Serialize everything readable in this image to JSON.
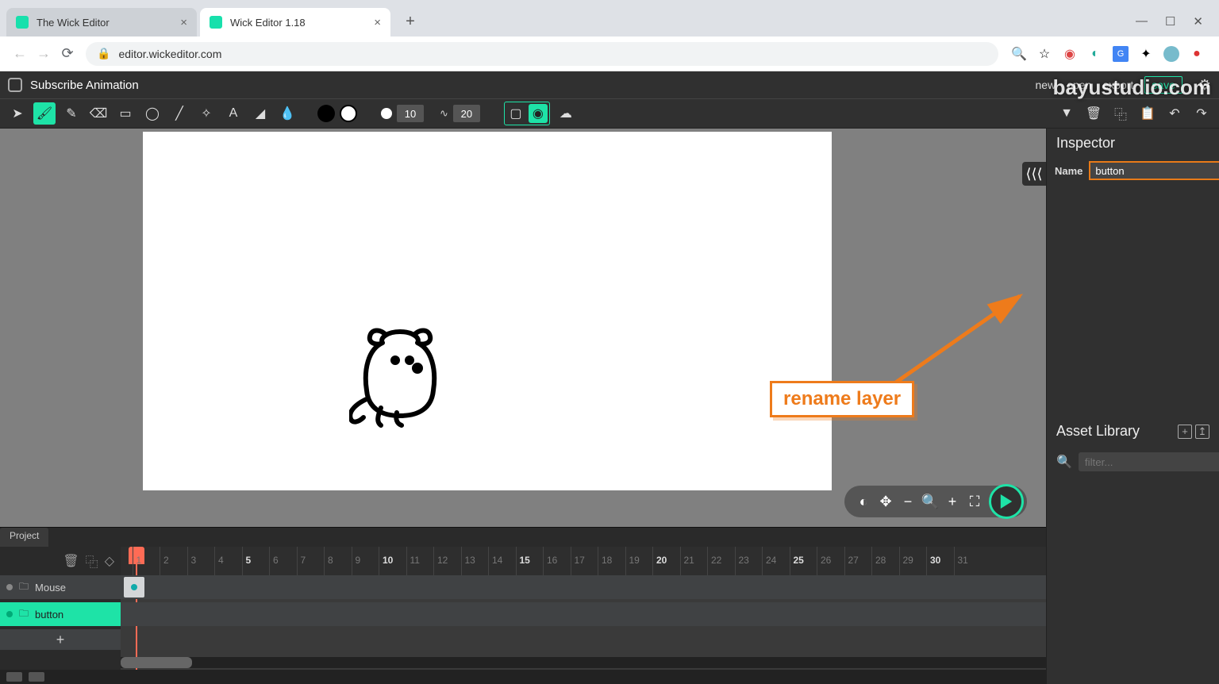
{
  "browser": {
    "tabs": [
      {
        "title": "The Wick Editor",
        "active": false
      },
      {
        "title": "Wick Editor 1.18",
        "active": true
      }
    ],
    "url": "editor.wickeditor.com"
  },
  "menubar": {
    "project_title": "Subscribe Animation",
    "items": [
      "new",
      "open",
      "export"
    ],
    "save": "save"
  },
  "toolbar": {
    "brush_size": "10",
    "smoothing": "20"
  },
  "inspector": {
    "title": "Inspector",
    "name_label": "Name",
    "name_value": "button"
  },
  "asset_library": {
    "title": "Asset Library",
    "filter_placeholder": "filter..."
  },
  "timeline": {
    "project_tab": "Project",
    "layers": [
      {
        "name": "Mouse",
        "active": false
      },
      {
        "name": "button",
        "active": true
      }
    ],
    "ruler_major": [
      5,
      10,
      15,
      20,
      25,
      30
    ],
    "ruler_minor": [
      1,
      2,
      3,
      4,
      6,
      7,
      8,
      9,
      11,
      12,
      13,
      14,
      16,
      17,
      18,
      19,
      21,
      22,
      23,
      24,
      26,
      27,
      28,
      29,
      31
    ],
    "add_layer": "+"
  },
  "annotation": {
    "text": "rename layer"
  },
  "watermark": "bayustudio.com"
}
